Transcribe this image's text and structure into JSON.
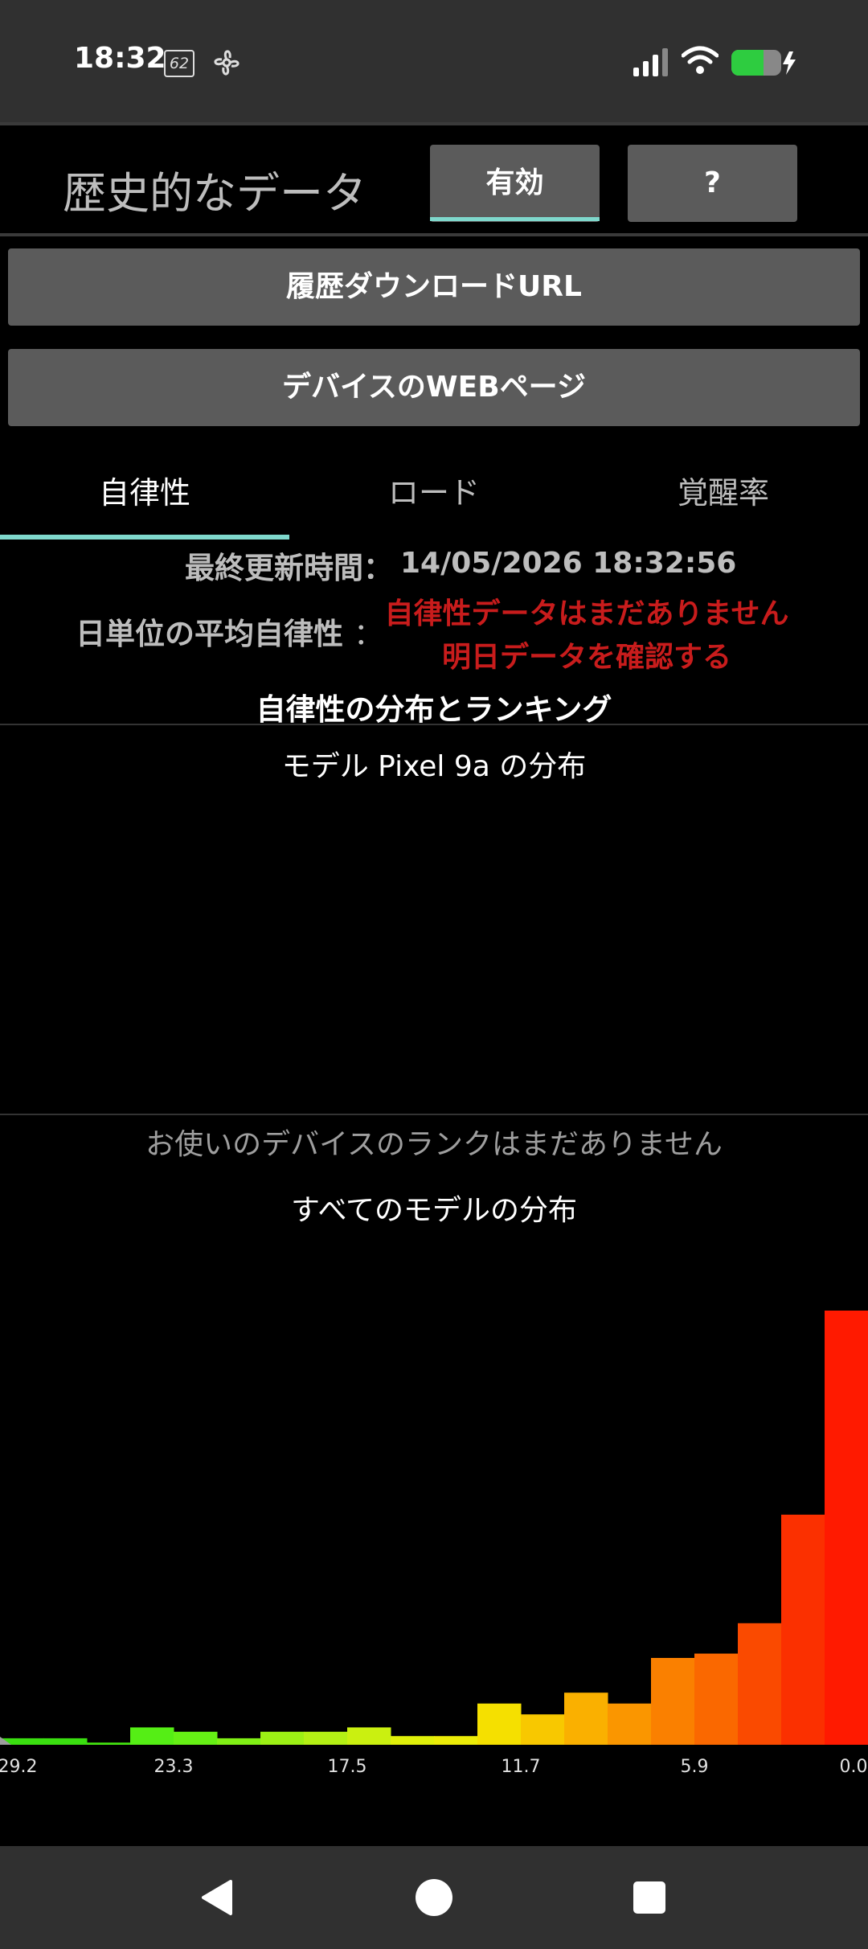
{
  "status_bar": {
    "time": "18:32",
    "badge": "62",
    "icons": [
      "fan-icon",
      "signal-icon",
      "wifi-icon",
      "battery-charging-icon"
    ],
    "battery_color": "#2ecc40"
  },
  "header": {
    "title": "歴史的なデータ",
    "enable_label": "有効",
    "help_label": "?"
  },
  "buttons": {
    "download_url": "履歴ダウンロードURL",
    "device_web": "デバイスのWEBページ"
  },
  "tabs": [
    {
      "label": "自律性",
      "active": true
    },
    {
      "label": "ロード",
      "active": false
    },
    {
      "label": "覚醒率",
      "active": false
    }
  ],
  "info": {
    "last_update_label": "最終更新時間：",
    "last_update_value": "14/05/2026 18:32:56",
    "avg_label": "日単位の平均自律性",
    "avg_colon": "：",
    "no_data_line1": "自律性データはまだありません",
    "no_data_line2": "明日データを確認する",
    "section_title": "自律性の分布とランキング",
    "model_distribution": "モデル Pixel 9a の分布",
    "no_rank": "お使いのデバイスのランクはまだありません",
    "all_models_distribution": "すべてのモデルの分布"
  },
  "colors": {
    "accent": "#7fd8cc",
    "button_bg": "#5b5b5b",
    "warning_text": "#c81c1c"
  },
  "chart_data": {
    "type": "bar",
    "title": "すべてのモデルの分布",
    "x_ticks": [
      "29.2",
      "23.3",
      "17.5",
      "11.7",
      "5.9",
      "0.0"
    ],
    "xlim": [
      29.2,
      0.0
    ],
    "bins": 20,
    "values": [
      1.5,
      1.5,
      0.5,
      4.0,
      3.0,
      1.5,
      3.0,
      3.0,
      4.0,
      2.0,
      2.0,
      9.5,
      7.0,
      12.0,
      9.5,
      20.0,
      21.0,
      28.0,
      53.0,
      100.0
    ],
    "colors": [
      "#3adf10",
      "#3adf10",
      "#44e610",
      "#55ee15",
      "#66f015",
      "#80f015",
      "#9cf015",
      "#b4f015",
      "#caf010",
      "#e0f00a",
      "#ecec08",
      "#f5e000",
      "#f8c800",
      "#fab000",
      "#fa9600",
      "#fa8000",
      "#fa6800",
      "#fa4a00",
      "#fb3000",
      "#ff1a00"
    ],
    "ylim": [
      0,
      100
    ],
    "grid": false,
    "legend": "none"
  }
}
